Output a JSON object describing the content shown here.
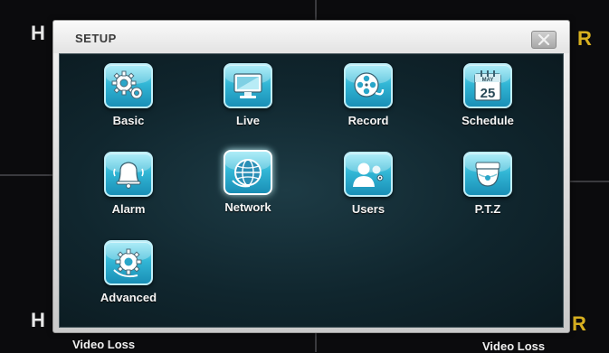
{
  "background": {
    "corner_top_left": "H",
    "corner_top_right": "R",
    "corner_bottom_left": "H",
    "corner_bottom_right": "R",
    "video_loss_left": "Video Loss",
    "video_loss_right": "Video Loss"
  },
  "dialog": {
    "title": "SETUP",
    "items": [
      {
        "label": "Basic",
        "icon": "gears-icon"
      },
      {
        "label": "Live",
        "icon": "monitor-icon"
      },
      {
        "label": "Record",
        "icon": "film-reel-icon"
      },
      {
        "label": "Schedule",
        "icon": "calendar-icon",
        "calendar_month": "MAY",
        "calendar_day": "25"
      },
      {
        "label": "Alarm",
        "icon": "bell-icon"
      },
      {
        "label": "Network",
        "icon": "globe-icon",
        "selected": true
      },
      {
        "label": "Users",
        "icon": "users-icon"
      },
      {
        "label": "P.T.Z",
        "icon": "dome-camera-icon"
      },
      {
        "label": "Advanced",
        "icon": "advanced-gear-icon"
      }
    ]
  },
  "colors": {
    "accent": "#33b7d6",
    "corner_r": "#d8b020",
    "panel_background": "#10262e"
  }
}
